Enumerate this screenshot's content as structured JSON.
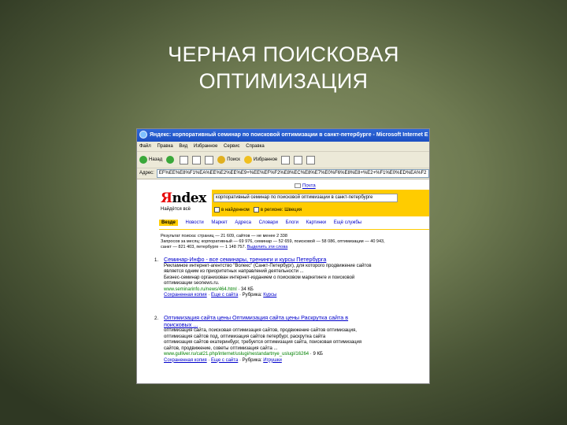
{
  "slide": {
    "title_line1": "ЧЕРНАЯ ПОИСКОВАЯ",
    "title_line2": "ОПТИМИЗАЦИЯ"
  },
  "browser": {
    "window_title": "Яндекс: корпоративный семинар по поисковой оптимизации в санкт-петербурге - Microsoft Internet E",
    "menu": [
      "Файл",
      "Правка",
      "Вид",
      "Избранное",
      "Сервис",
      "Справка"
    ],
    "toolbar": {
      "back_label": "Назад",
      "search_label": "Поиск",
      "favorites_label": "Избранное"
    },
    "address_label": "Адрес:",
    "address_value": "EF%EE%E8%F1%EA%EE%E2%EE%E9+%EE%EF%F2%E8%EC%E8%E7%E0%F6%E8%E8+%E2+%F1%E0%ED%EA%F2"
  },
  "yandex": {
    "mail_link": "Почта",
    "logo_first": "Я",
    "logo_rest": "ndex",
    "tagline": "Найдётся всё",
    "query": "корпоративный семинар по поисковой оптимизации в санкт-петербурге",
    "opt_found": "в найденном",
    "opt_region": "в регионе: Швеция",
    "tabs": [
      "Везде",
      "Новости",
      "Маркет",
      "Адреса",
      "Словари",
      "Блоги",
      "Картинки",
      "Ещё службы"
    ],
    "stats_line1": "Результат поиска: страниц — 21 609, сайтов — не менее 2 338",
    "stats_line2": "Запросов за месяц: корпоративный — 69 976, семинар — 52 659, поисковой — 58 086, оптимизации — 40 943,",
    "stats_line3": "санкт — 821 403, петербурге — 1 148 757.",
    "stats_link": "Выделить эти слова",
    "results": [
      {
        "num": "1.",
        "title": "Семинар-Инфо - все семинары, тренинги и курсы Петербурга",
        "snippet1": "Рекламное интернет-агентство \"Волекс\" (Санкт-Петербург), для которого продвижение сайтов",
        "snippet2": "является одним из приоритетных направлений деятельности ...",
        "snippet3": "Бизнес-семинар организован интернет-изданием о поисковом маркетинге и поисковой",
        "snippet4": "оптимизации seonews.ru.",
        "url": "www.seminarinfo.ru/news/464.html",
        "size": "· 34 КБ",
        "saved": "Сохраненная копия",
        "more": "Еще с сайта",
        "rubric_label": "· Рубрика:",
        "rubric": "Курсы"
      },
      {
        "num": "2.",
        "title1": "Оптимизация сайта цены Оптимизация сайта цены Раскрутка сайта в",
        "title2": "поисковых ...",
        "snippet1": "оптимизация сайта, поисковая оптимизация сайтов, продвижение сайтов оптимизация,",
        "snippet2": "оптимизация сайтов под, оптимизация сайтов петербург, раскрутка сайта",
        "snippet3": "оптимизация сайтов екатеринбург, требуется оптимизация сайта, поисковая оптимизация",
        "snippet4": "сайтов, продвижение, советы оптимизация сайта ...",
        "url": "www.gulliver.ru/cat21.php/internet/uslugi/nestandartnye_uslugi/16264",
        "size": "· 9 КБ",
        "saved": "Сохраненная копия",
        "more": "Еще с сайта",
        "rubric_label": "· Рубрика:",
        "rubric": "Игрушки"
      }
    ]
  },
  "colors": {
    "background": "#6f7b52",
    "yandex_yellow": "#ffcc00",
    "link_blue": "#0000cc",
    "url_green": "#008000",
    "xp_titlebar": "#2f68d8"
  }
}
